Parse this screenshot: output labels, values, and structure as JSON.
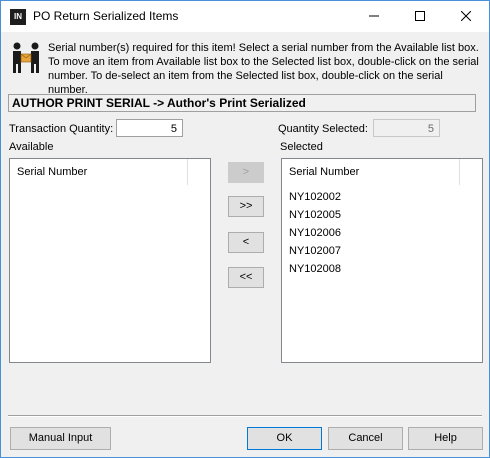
{
  "window": {
    "app_icon_text": "IN",
    "title": "PO Return Serialized Items",
    "icons": {
      "minimize": "minimize-icon",
      "maximize": "maximize-icon",
      "close": "close-icon",
      "info": "people-exchange-icon"
    }
  },
  "info": {
    "message": "Serial number(s) required for this item! Select a serial number from the Available list box. To move an item from Available list box to the Selected list box, double-click on the serial number. To de-select an item from the Selected list box, double-click on the serial number."
  },
  "item_header": "AUTHOR PRINT SERIAL -> Author's Print Serialized",
  "transaction_quantity": {
    "label": "Transaction Quantity:",
    "value": "5"
  },
  "quantity_selected": {
    "label": "Quantity Selected:",
    "value": "5"
  },
  "available": {
    "label": "Available",
    "column": "Serial Number",
    "items": []
  },
  "selected": {
    "label": "Selected",
    "column": "Serial Number",
    "items": [
      "NY102002",
      "NY102005",
      "NY102006",
      "NY102007",
      "NY102008"
    ]
  },
  "move_buttons": {
    "add_one": ">",
    "add_all": ">>",
    "remove_one": "<",
    "remove_all": "<<"
  },
  "footer": {
    "manual_input": "Manual Input",
    "ok": "OK",
    "cancel": "Cancel",
    "help": "Help"
  },
  "colors": {
    "window_border": "#4a90d9",
    "background": "#f0f0f0",
    "default_button_border": "#0078d7"
  }
}
